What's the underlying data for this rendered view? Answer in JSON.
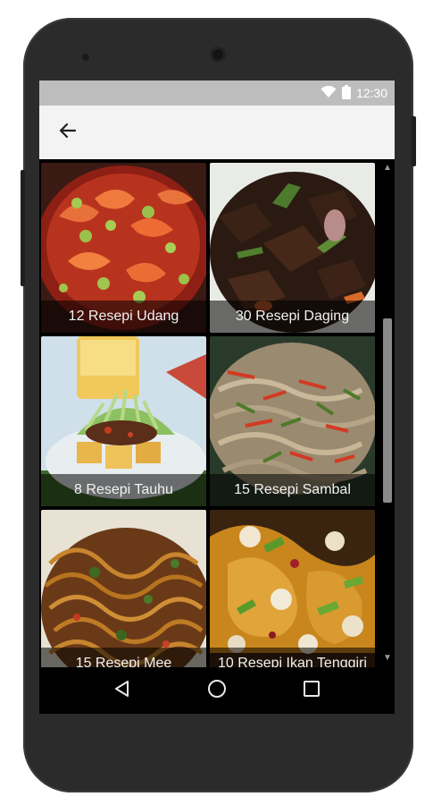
{
  "status_bar": {
    "time": "12:30",
    "icons": [
      "wifi-icon",
      "battery-icon"
    ]
  },
  "app_bar": {
    "back_icon": "arrow-left-icon"
  },
  "recipes": [
    {
      "label": "12 Resepi Udang",
      "image": "shrimp-dish-photo"
    },
    {
      "label": "30 Resepi Daging",
      "image": "beef-dish-photo"
    },
    {
      "label": "8 Resepi Tauhu",
      "image": "tofu-dish-photo"
    },
    {
      "label": "15 Resepi Sambal",
      "image": "sambal-dish-photo"
    },
    {
      "label": "15 Resepi Mee",
      "image": "noodle-dish-photo"
    },
    {
      "label": "10 Resepi Ikan Tenggiri",
      "image": "mackerel-dish-photo"
    }
  ],
  "nav_bar": {
    "buttons": [
      "back-triangle-icon",
      "home-circle-icon",
      "recents-square-icon"
    ]
  },
  "colors": {
    "status_bar": "#bdbdbd",
    "app_bar": "#f3f3f3",
    "phone_body": "#2b2b2b",
    "caption_overlay": "rgba(0,0,0,0.55)"
  }
}
